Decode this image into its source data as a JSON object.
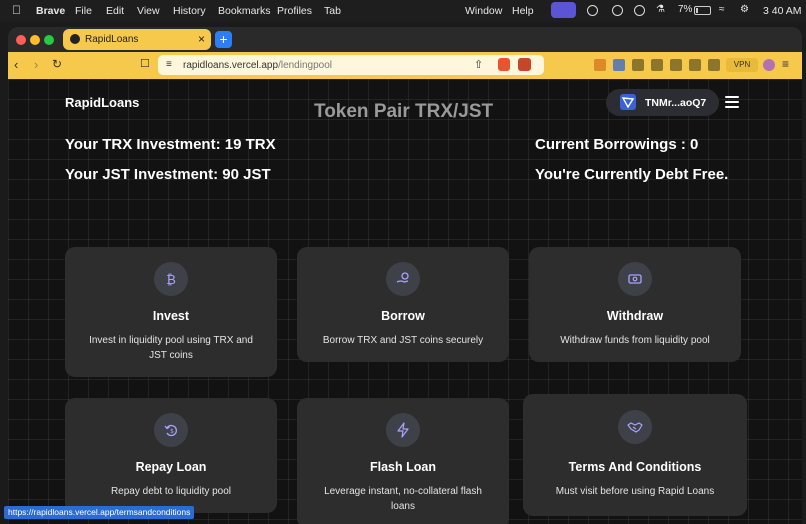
{
  "menubar": {
    "app": "Brave",
    "items": [
      "File",
      "Edit",
      "View",
      "History",
      "Bookmarks",
      "Profiles",
      "Tab"
    ],
    "right_items": [
      "Window",
      "Help"
    ],
    "battery": "7%",
    "time": "3 40 AM"
  },
  "browser": {
    "tab_title": "RapidLoans",
    "url_host": "rapidloans.vercel.app",
    "url_path": "/lendingpool",
    "vpn_label": "VPN",
    "accent": "#f6c94c",
    "status_url": "https://rapidloans.vercel.app/termsandconditions"
  },
  "page": {
    "brand": "RapidLoans",
    "pair_title": "Token Pair TRX/JST",
    "wallet_address": "TNMr...aoQ7",
    "trx_investment": "Your TRX Investment: 19 TRX",
    "jst_investment": "Your JST Investment: 90 JST",
    "current_borrowings": "Current Borrowings : 0",
    "debt_status": "You're Currently Debt Free.",
    "cards": [
      {
        "icon": "bitcoin-icon",
        "title": "Invest",
        "desc": "Invest in liquidity pool using TRX and JST coins"
      },
      {
        "icon": "hand-coin-icon",
        "title": "Borrow",
        "desc": "Borrow TRX and JST coins securely"
      },
      {
        "icon": "cash-icon",
        "title": "Withdraw",
        "desc": "Withdraw funds from liquidity pool"
      },
      {
        "icon": "repay-icon",
        "title": "Repay Loan",
        "desc": "Repay debt to liquidity pool"
      },
      {
        "icon": "lightning-icon",
        "title": "Flash Loan",
        "desc": "Leverage instant, no-collateral flash loans"
      },
      {
        "icon": "handshake-icon",
        "title": "Terms And Conditions",
        "desc": "Must visit before using Rapid Loans"
      }
    ]
  }
}
